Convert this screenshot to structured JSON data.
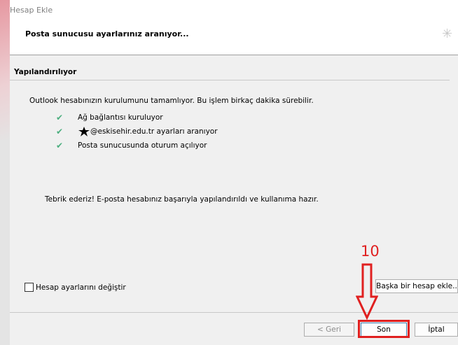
{
  "window": {
    "title": "Hesap Ekle"
  },
  "header": {
    "title": "Posta sunucusu ayarlarınız aranıyor..."
  },
  "section": {
    "title": "Yapılandırılıyor"
  },
  "description": "Outlook hesabınızın kurulumunu tamamlıyor. Bu işlem birkaç dakika sürebilir.",
  "steps": [
    {
      "label": "Ağ bağlantısı kuruluyor",
      "status": "done"
    },
    {
      "label": "@eskisehir.edu.tr ayarları aranıyor",
      "status": "done"
    },
    {
      "label": "Posta sunucusunda oturum açılıyor",
      "status": "done"
    }
  ],
  "success_message": "Tebrik ederiz! E-posta hesabınız başarıyla yapılandırıldı ve kullanıma hazır.",
  "change_settings": {
    "label": "Hesap ayarlarını değiştir",
    "checked": false
  },
  "buttons": {
    "add_another": "Başka bir hesap ekle..",
    "back": "< Geri",
    "finish": "Son",
    "cancel": "İptal"
  },
  "annotation": {
    "step_number": "10",
    "color": "#e02020"
  },
  "colors": {
    "check": "#4caf7f"
  }
}
